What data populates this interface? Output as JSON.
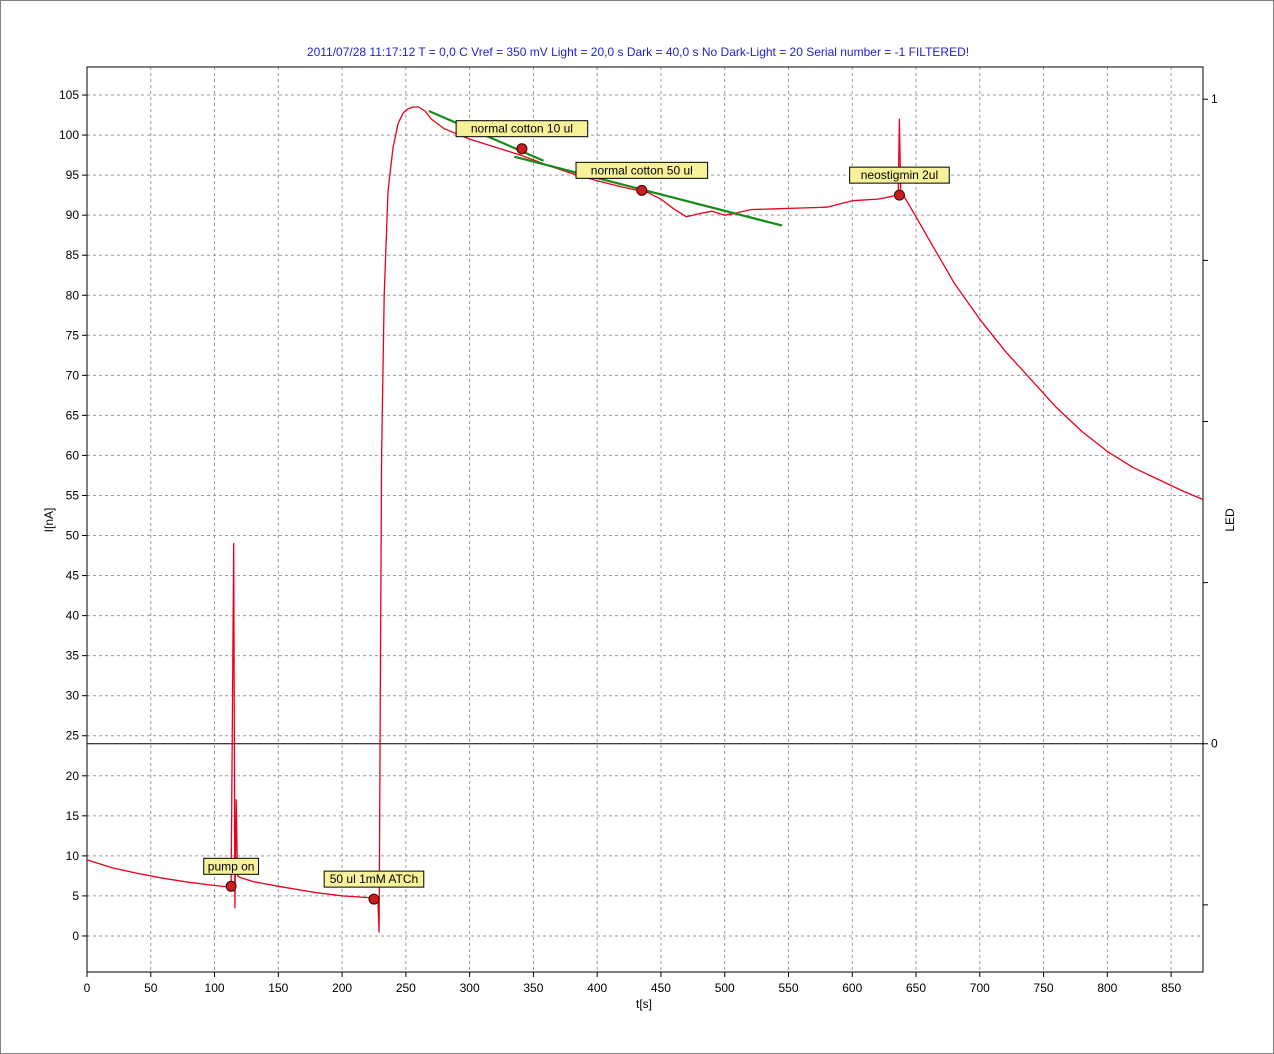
{
  "chart_data": {
    "type": "line",
    "title": "2011/07/28 11:17:12   T = 0,0 C   Vref = 350 mV   Light = 20,0 s   Dark = 40,0 s   No Dark-Light = 20   Serial number = -1 FILTERED!",
    "xlabel": "t[s]",
    "ylabel": "I[nA]",
    "y2label": "LED",
    "xlim": [
      0,
      875
    ],
    "ylim": [
      -4.5,
      108.5
    ],
    "xticks": [
      0,
      50,
      100,
      150,
      200,
      250,
      300,
      350,
      400,
      450,
      500,
      550,
      600,
      650,
      700,
      750,
      800,
      850
    ],
    "yticks": [
      0,
      5,
      10,
      15,
      20,
      25,
      30,
      35,
      40,
      45,
      50,
      55,
      60,
      65,
      70,
      75,
      80,
      85,
      90,
      95,
      100,
      105
    ],
    "y2_tick_labels": [
      "1",
      "0"
    ],
    "grid": true,
    "colors": {
      "series": "#e8001c",
      "fit": "#178a17",
      "title": "#1f1fd0",
      "annotation_bg": "#f7f199",
      "marker": "#c81e1e"
    },
    "series": [
      {
        "x": [
          0,
          20,
          40,
          60,
          80,
          100,
          113,
          115,
          116,
          117,
          118,
          120,
          130,
          150,
          180,
          200,
          220,
          228,
          229,
          230,
          231,
          233,
          236,
          240,
          244,
          248,
          252,
          256,
          260,
          265,
          270,
          280,
          300,
          320,
          340,
          360,
          380,
          400,
          420,
          440,
          450,
          460,
          470,
          480,
          490,
          500,
          510,
          520,
          540,
          560,
          580,
          600,
          620,
          630,
          636,
          637,
          638,
          640,
          650,
          660,
          680,
          700,
          720,
          740,
          760,
          780,
          800,
          820,
          840,
          860,
          875
        ],
        "values": [
          9.5,
          8.5,
          7.8,
          7.2,
          6.7,
          6.3,
          6.1,
          49.0,
          3.5,
          17.0,
          7.5,
          7.3,
          6.8,
          6.2,
          5.4,
          5.0,
          4.8,
          4.7,
          0.5,
          30.0,
          60.0,
          80.0,
          93.0,
          98.5,
          101.5,
          102.8,
          103.3,
          103.5,
          103.5,
          103.0,
          102.0,
          100.8,
          99.5,
          98.5,
          97.5,
          96.3,
          95.2,
          94.3,
          93.5,
          92.8,
          92.0,
          90.8,
          89.8,
          90.2,
          90.5,
          90.0,
          90.3,
          90.7,
          90.8,
          90.9,
          91.0,
          91.8,
          92.0,
          92.3,
          92.6,
          102.0,
          93.0,
          92.5,
          89.8,
          87.0,
          81.5,
          77.0,
          73.0,
          69.5,
          66.0,
          63.0,
          60.5,
          58.5,
          57.0,
          55.5,
          54.5
        ]
      }
    ],
    "fit_lines": [
      {
        "x": [
          268,
          358
        ],
        "values": [
          103.0,
          96.8
        ]
      },
      {
        "x": [
          335,
          545
        ],
        "values": [
          97.3,
          88.7
        ]
      }
    ],
    "annotations": [
      {
        "label": "pump on",
        "x": 113,
        "y": 6.2
      },
      {
        "label": "50 ul 1mM ATCh",
        "x": 225,
        "y": 4.6
      },
      {
        "label": "normal cotton 10 ul",
        "x": 341,
        "y": 98.3
      },
      {
        "label": "normal cotton 50 ul",
        "x": 435,
        "y": 93.1
      },
      {
        "label": "neostigmin 2ul",
        "x": 637,
        "y": 92.5
      }
    ],
    "led_line_y": 24
  }
}
